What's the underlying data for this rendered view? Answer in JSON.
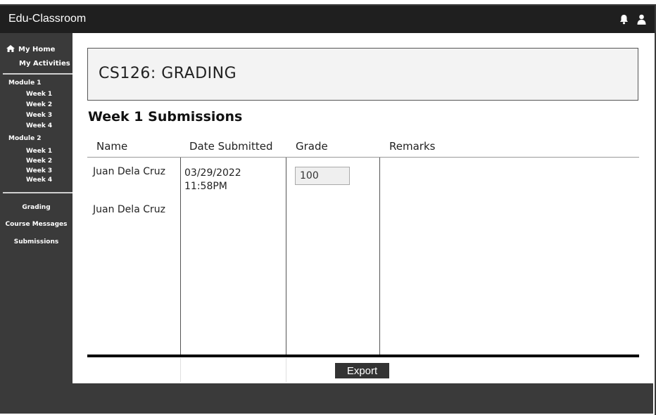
{
  "app": {
    "title": "Edu-Classroom"
  },
  "topbar": {
    "icons": [
      "bell-icon",
      "user-icon"
    ]
  },
  "sidebar": {
    "home_label": "My Home",
    "activities_label": "My Activities",
    "modules": [
      {
        "label": "Module 1",
        "weeks": [
          "Week 1",
          "Week 2",
          "Week 3",
          "Week 4"
        ]
      },
      {
        "label": "Module 2",
        "weeks": [
          "Week 1",
          "Week 2",
          "Week 3",
          "Week 4"
        ]
      }
    ],
    "nav": [
      "Grading",
      "Course Messages",
      "Submissions"
    ]
  },
  "main": {
    "course_title": "CS126: GRADING",
    "section_title": "Week 1 Submissions",
    "columns": [
      "Name",
      "Date Submitted",
      "Grade",
      "Remarks"
    ],
    "rows": [
      {
        "name": "Juan Dela Cruz",
        "date": "03/29/2022",
        "time": "11:58PM",
        "grade": "100"
      },
      {
        "name": "Juan Dela Cruz"
      }
    ],
    "export_label": "Export"
  },
  "colors": {
    "sidebar_bg": "#3a3a3a",
    "topbar_bg": "#1f1f1f",
    "course_box_bg": "#f3f3f3",
    "button_bg": "#333333"
  }
}
